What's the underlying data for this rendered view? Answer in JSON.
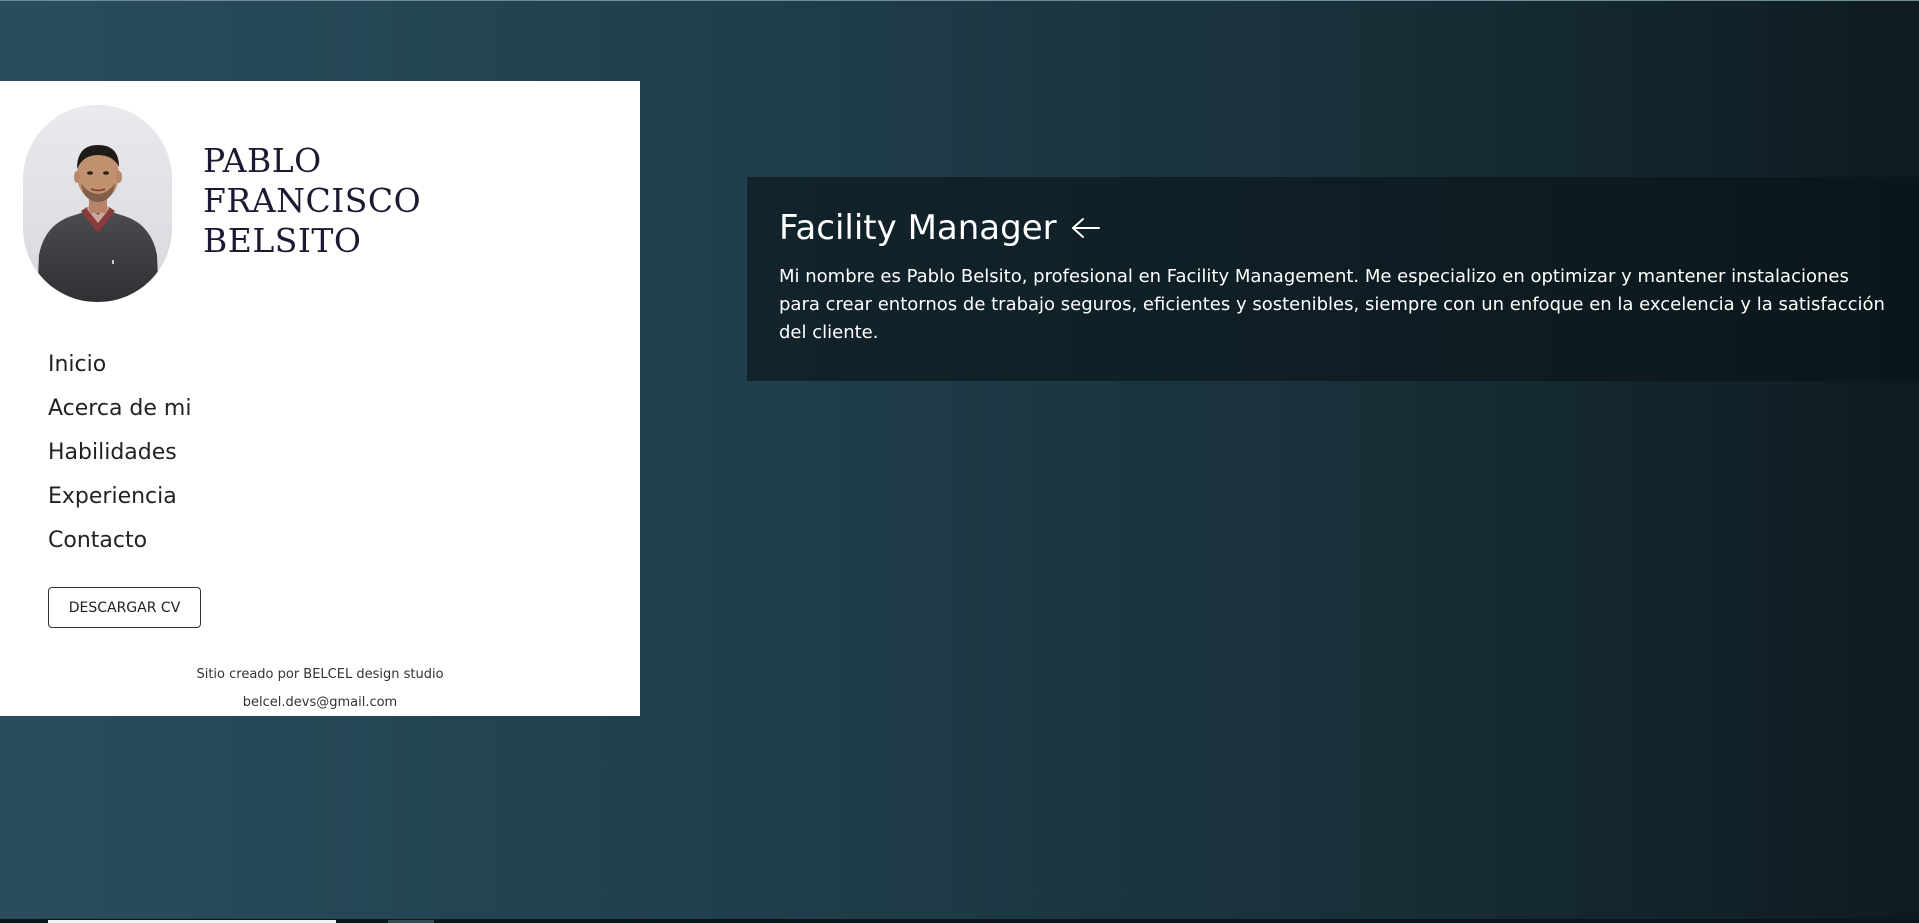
{
  "profile": {
    "name_lines": [
      "PABLO",
      "FRANCISCO",
      "BELSITO"
    ],
    "avatar_icon": "portrait-photo"
  },
  "nav": {
    "items": [
      {
        "label": "Inicio"
      },
      {
        "label": "Acerca de mi"
      },
      {
        "label": "Habilidades"
      },
      {
        "label": "Experiencia"
      },
      {
        "label": "Contacto"
      }
    ]
  },
  "cv_button": {
    "label": "DESCARGAR CV"
  },
  "footer": {
    "credit": "Sitio creado por BELCEL design studio",
    "email": "belcel.devs@gmail.com"
  },
  "hero": {
    "title": "Facility Manager",
    "arrow_icon": "arrow-left-icon",
    "text": "Mi nombre es Pablo Belsito, profesional en Facility Management. Me especializo en optimizar y mantener instalaciones para crear entornos de trabajo seguros, eficientes y sostenibles, siempre con un enfoque en la excelencia y la satisfacción del cliente."
  },
  "colors": {
    "background_left": "#2a4d5e",
    "background_right": "#0e1b20",
    "sidebar_bg": "#ffffff",
    "name_color": "#1c1a33",
    "hero_panel": "#0f1a1f"
  }
}
